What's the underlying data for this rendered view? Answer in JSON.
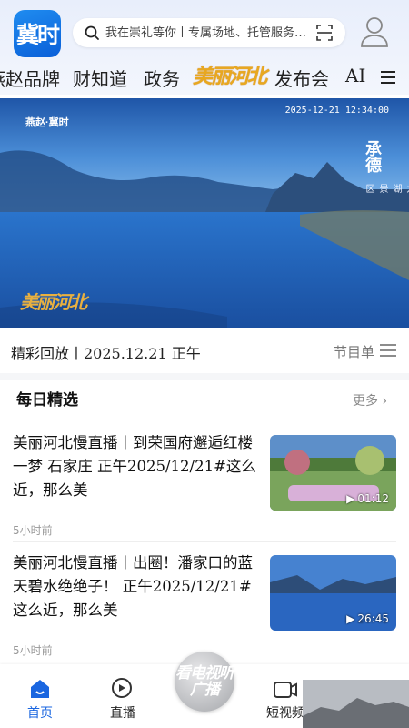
{
  "app": {
    "logo_text": "冀时"
  },
  "search": {
    "placeholder": "我在崇礼等你丨专属场地、托管服务…"
  },
  "nav": {
    "items": [
      "燕赵品牌",
      "财知道",
      "政务",
      "美丽河北",
      "发布会",
      "AI"
    ],
    "special_index": 3
  },
  "hero": {
    "timestamp": "2025-12-21 12:34:00",
    "city": "承德",
    "place": "宽城满族自治县 蟠龙湖景区",
    "watermark": "美丽河北",
    "badge": "燕赵·冀时"
  },
  "replay": {
    "text": "精彩回放丨2025.12.21 正午",
    "schedule_label": "节目单"
  },
  "section": {
    "title": "每日精选",
    "more_label": "更多"
  },
  "articles": [
    {
      "title": "美丽河北慢直播丨到荣国府邂逅红楼一梦 石家庄 正午2025/12/21#这么近，那么美",
      "time": "5小时前",
      "duration": "01:12"
    },
    {
      "title": "美丽河北慢直播丨出圈！潘家口的蓝天碧水绝绝子！ 正午2025/12/21#这么近，那么美",
      "time": "5小时前",
      "duration": "26:45"
    }
  ],
  "tabbar": {
    "items": [
      "首页",
      "直播",
      "短视频"
    ],
    "center_label": "看电视听广播",
    "active_color": "#1a66e0"
  },
  "colors": {
    "accent": "#1a66e0",
    "lake": "#1f5fb8",
    "sky": "#3b7fd2"
  }
}
